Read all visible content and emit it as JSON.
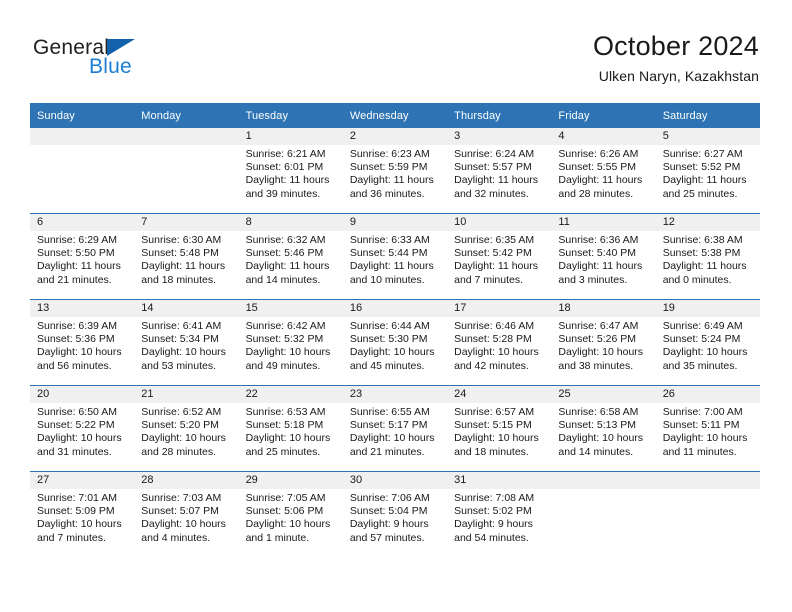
{
  "brand": {
    "name_part1": "General",
    "name_part2": "Blue",
    "triangle_icon": "triangle-icon",
    "accent_color": "#1b7fd4",
    "triangle_color": "#1162ab"
  },
  "header": {
    "title": "October 2024",
    "subtitle": "Ulken Naryn, Kazakhstan",
    "header_bg_color": "#2e74b5",
    "daynum_band_color": "#f0f0f0"
  },
  "weekdays": [
    "Sunday",
    "Monday",
    "Tuesday",
    "Wednesday",
    "Thursday",
    "Friday",
    "Saturday"
  ],
  "weeks": [
    [
      {
        "day": "",
        "lines": []
      },
      {
        "day": "",
        "lines": []
      },
      {
        "day": "1",
        "lines": [
          "Sunrise: 6:21 AM",
          "Sunset: 6:01 PM",
          "Daylight: 11 hours",
          "and 39 minutes."
        ]
      },
      {
        "day": "2",
        "lines": [
          "Sunrise: 6:23 AM",
          "Sunset: 5:59 PM",
          "Daylight: 11 hours",
          "and 36 minutes."
        ]
      },
      {
        "day": "3",
        "lines": [
          "Sunrise: 6:24 AM",
          "Sunset: 5:57 PM",
          "Daylight: 11 hours",
          "and 32 minutes."
        ]
      },
      {
        "day": "4",
        "lines": [
          "Sunrise: 6:26 AM",
          "Sunset: 5:55 PM",
          "Daylight: 11 hours",
          "and 28 minutes."
        ]
      },
      {
        "day": "5",
        "lines": [
          "Sunrise: 6:27 AM",
          "Sunset: 5:52 PM",
          "Daylight: 11 hours",
          "and 25 minutes."
        ]
      }
    ],
    [
      {
        "day": "6",
        "lines": [
          "Sunrise: 6:29 AM",
          "Sunset: 5:50 PM",
          "Daylight: 11 hours",
          "and 21 minutes."
        ]
      },
      {
        "day": "7",
        "lines": [
          "Sunrise: 6:30 AM",
          "Sunset: 5:48 PM",
          "Daylight: 11 hours",
          "and 18 minutes."
        ]
      },
      {
        "day": "8",
        "lines": [
          "Sunrise: 6:32 AM",
          "Sunset: 5:46 PM",
          "Daylight: 11 hours",
          "and 14 minutes."
        ]
      },
      {
        "day": "9",
        "lines": [
          "Sunrise: 6:33 AM",
          "Sunset: 5:44 PM",
          "Daylight: 11 hours",
          "and 10 minutes."
        ]
      },
      {
        "day": "10",
        "lines": [
          "Sunrise: 6:35 AM",
          "Sunset: 5:42 PM",
          "Daylight: 11 hours",
          "and 7 minutes."
        ]
      },
      {
        "day": "11",
        "lines": [
          "Sunrise: 6:36 AM",
          "Sunset: 5:40 PM",
          "Daylight: 11 hours",
          "and 3 minutes."
        ]
      },
      {
        "day": "12",
        "lines": [
          "Sunrise: 6:38 AM",
          "Sunset: 5:38 PM",
          "Daylight: 11 hours",
          "and 0 minutes."
        ]
      }
    ],
    [
      {
        "day": "13",
        "lines": [
          "Sunrise: 6:39 AM",
          "Sunset: 5:36 PM",
          "Daylight: 10 hours",
          "and 56 minutes."
        ]
      },
      {
        "day": "14",
        "lines": [
          "Sunrise: 6:41 AM",
          "Sunset: 5:34 PM",
          "Daylight: 10 hours",
          "and 53 minutes."
        ]
      },
      {
        "day": "15",
        "lines": [
          "Sunrise: 6:42 AM",
          "Sunset: 5:32 PM",
          "Daylight: 10 hours",
          "and 49 minutes."
        ]
      },
      {
        "day": "16",
        "lines": [
          "Sunrise: 6:44 AM",
          "Sunset: 5:30 PM",
          "Daylight: 10 hours",
          "and 45 minutes."
        ]
      },
      {
        "day": "17",
        "lines": [
          "Sunrise: 6:46 AM",
          "Sunset: 5:28 PM",
          "Daylight: 10 hours",
          "and 42 minutes."
        ]
      },
      {
        "day": "18",
        "lines": [
          "Sunrise: 6:47 AM",
          "Sunset: 5:26 PM",
          "Daylight: 10 hours",
          "and 38 minutes."
        ]
      },
      {
        "day": "19",
        "lines": [
          "Sunrise: 6:49 AM",
          "Sunset: 5:24 PM",
          "Daylight: 10 hours",
          "and 35 minutes."
        ]
      }
    ],
    [
      {
        "day": "20",
        "lines": [
          "Sunrise: 6:50 AM",
          "Sunset: 5:22 PM",
          "Daylight: 10 hours",
          "and 31 minutes."
        ]
      },
      {
        "day": "21",
        "lines": [
          "Sunrise: 6:52 AM",
          "Sunset: 5:20 PM",
          "Daylight: 10 hours",
          "and 28 minutes."
        ]
      },
      {
        "day": "22",
        "lines": [
          "Sunrise: 6:53 AM",
          "Sunset: 5:18 PM",
          "Daylight: 10 hours",
          "and 25 minutes."
        ]
      },
      {
        "day": "23",
        "lines": [
          "Sunrise: 6:55 AM",
          "Sunset: 5:17 PM",
          "Daylight: 10 hours",
          "and 21 minutes."
        ]
      },
      {
        "day": "24",
        "lines": [
          "Sunrise: 6:57 AM",
          "Sunset: 5:15 PM",
          "Daylight: 10 hours",
          "and 18 minutes."
        ]
      },
      {
        "day": "25",
        "lines": [
          "Sunrise: 6:58 AM",
          "Sunset: 5:13 PM",
          "Daylight: 10 hours",
          "and 14 minutes."
        ]
      },
      {
        "day": "26",
        "lines": [
          "Sunrise: 7:00 AM",
          "Sunset: 5:11 PM",
          "Daylight: 10 hours",
          "and 11 minutes."
        ]
      }
    ],
    [
      {
        "day": "27",
        "lines": [
          "Sunrise: 7:01 AM",
          "Sunset: 5:09 PM",
          "Daylight: 10 hours",
          "and 7 minutes."
        ]
      },
      {
        "day": "28",
        "lines": [
          "Sunrise: 7:03 AM",
          "Sunset: 5:07 PM",
          "Daylight: 10 hours",
          "and 4 minutes."
        ]
      },
      {
        "day": "29",
        "lines": [
          "Sunrise: 7:05 AM",
          "Sunset: 5:06 PM",
          "Daylight: 10 hours",
          "and 1 minute."
        ]
      },
      {
        "day": "30",
        "lines": [
          "Sunrise: 7:06 AM",
          "Sunset: 5:04 PM",
          "Daylight: 9 hours",
          "and 57 minutes."
        ]
      },
      {
        "day": "31",
        "lines": [
          "Sunrise: 7:08 AM",
          "Sunset: 5:02 PM",
          "Daylight: 9 hours",
          "and 54 minutes."
        ]
      },
      {
        "day": "",
        "lines": []
      },
      {
        "day": "",
        "lines": []
      }
    ]
  ]
}
